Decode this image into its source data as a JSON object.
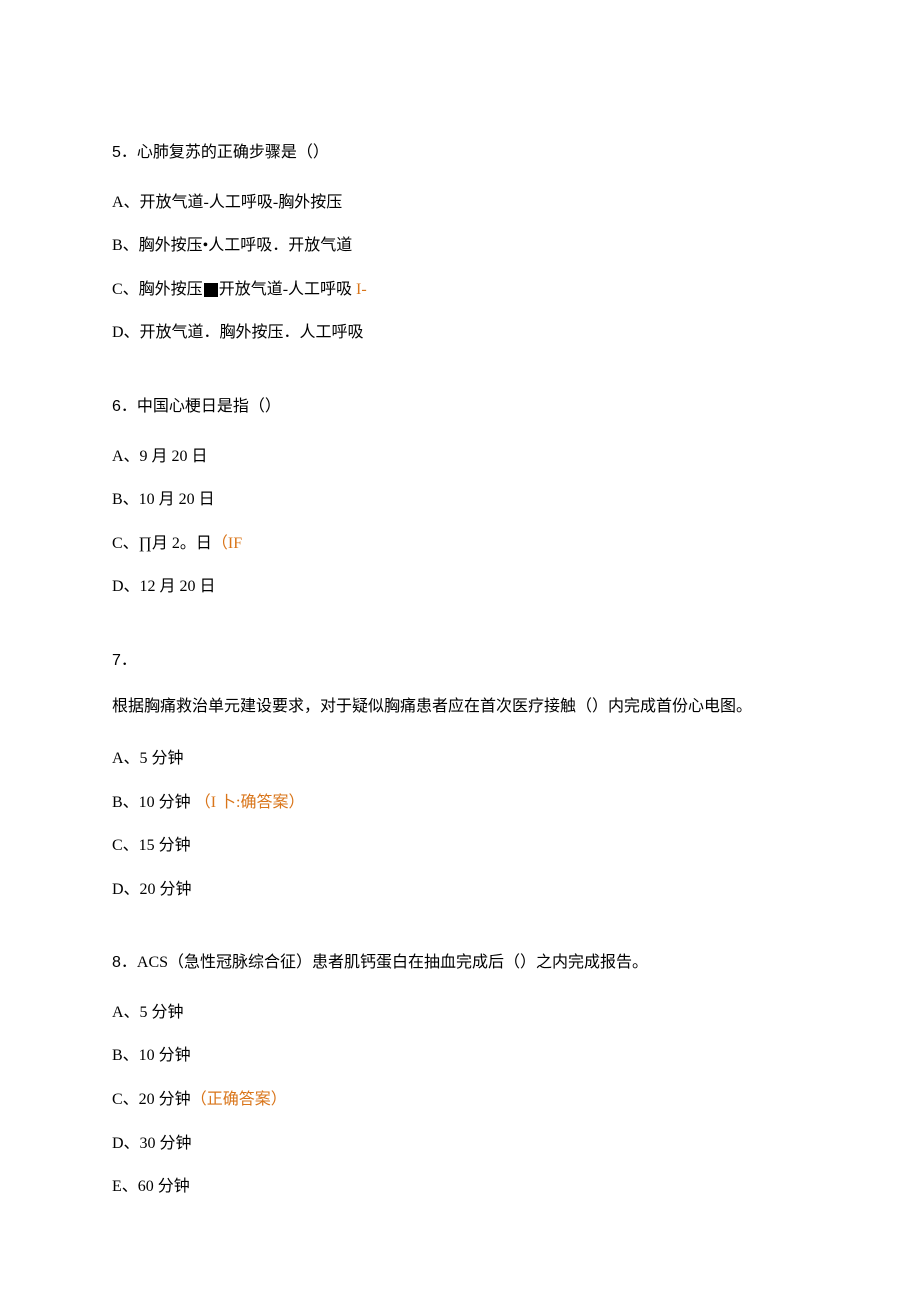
{
  "q5": {
    "number": "5",
    "text": "．心肺复苏的正确步骤是（）",
    "options": {
      "A": "A、开放气道-人工呼吸-胸外按压",
      "B": "B、胸外按压•人工呼吸．开放气道",
      "C_prefix": "C、胸外按压",
      "C_suffix": "开放气道-人工呼吸",
      "C_mark": " I-",
      "D": "D、开放气道．胸外按压．人工呼吸"
    }
  },
  "q6": {
    "number": "6",
    "text": "．中国心梗日是指（）",
    "options": {
      "A": "A、9 月 20 日",
      "B": "B、10 月 20 日",
      "C_text": "C、∏月 2。日",
      "C_mark": "（IF",
      "D": "D、12 月 20 日"
    }
  },
  "q7": {
    "number": "7",
    "dot": "．",
    "text": "根据胸痛救治单元建设要求，对于疑似胸痛患者应在首次医疗接触（）内完成首份心电图。",
    "options": {
      "A": "A、5 分钟",
      "B_text": "B、10 分钟",
      "B_mark": "（I 卜:确答案）",
      "C": "C、15 分钟",
      "D": "D、20 分钟"
    }
  },
  "q8": {
    "number": "8",
    "text": "．ACS（急性冠脉综合征）患者肌钙蛋白在抽血完成后（）之内完成报告。",
    "options": {
      "A": "A、5 分钟",
      "B": "B、10 分钟",
      "C_text": "C、20 分钟",
      "C_mark": "（正确答案）",
      "D": "D、30 分钟",
      "E": "E、60 分钟"
    }
  }
}
